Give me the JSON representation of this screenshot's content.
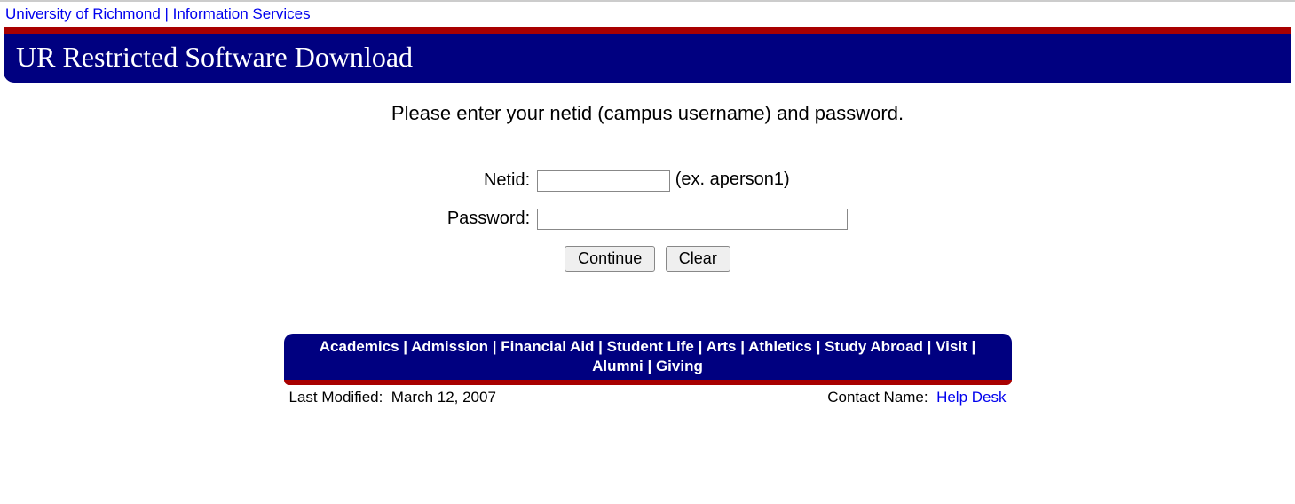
{
  "topnav": {
    "link1": "University of Richmond",
    "separator": " | ",
    "link2": "Information Services"
  },
  "header": {
    "title": "UR Restricted Software Download"
  },
  "main": {
    "instruction": "Please enter your netid (campus username) and password.",
    "netid_label": "Netid:",
    "netid_value": "",
    "netid_example": "(ex. aperson1)",
    "password_label": "Password:",
    "password_value": "",
    "continue_label": "Continue",
    "clear_label": "Clear"
  },
  "footer": {
    "links": {
      "academics": "Academics",
      "admission": "Admission",
      "financial_aid": "Financial Aid",
      "student_life": "Student Life",
      "arts": "Arts",
      "athletics": "Athletics",
      "study_abroad": "Study Abroad",
      "visit": "Visit",
      "alumni": "Alumni",
      "giving": "Giving"
    },
    "last_modified_label": "Last Modified:",
    "last_modified_value": "March 12, 2007",
    "contact_label": "Contact Name:",
    "contact_link": "Help Desk"
  }
}
